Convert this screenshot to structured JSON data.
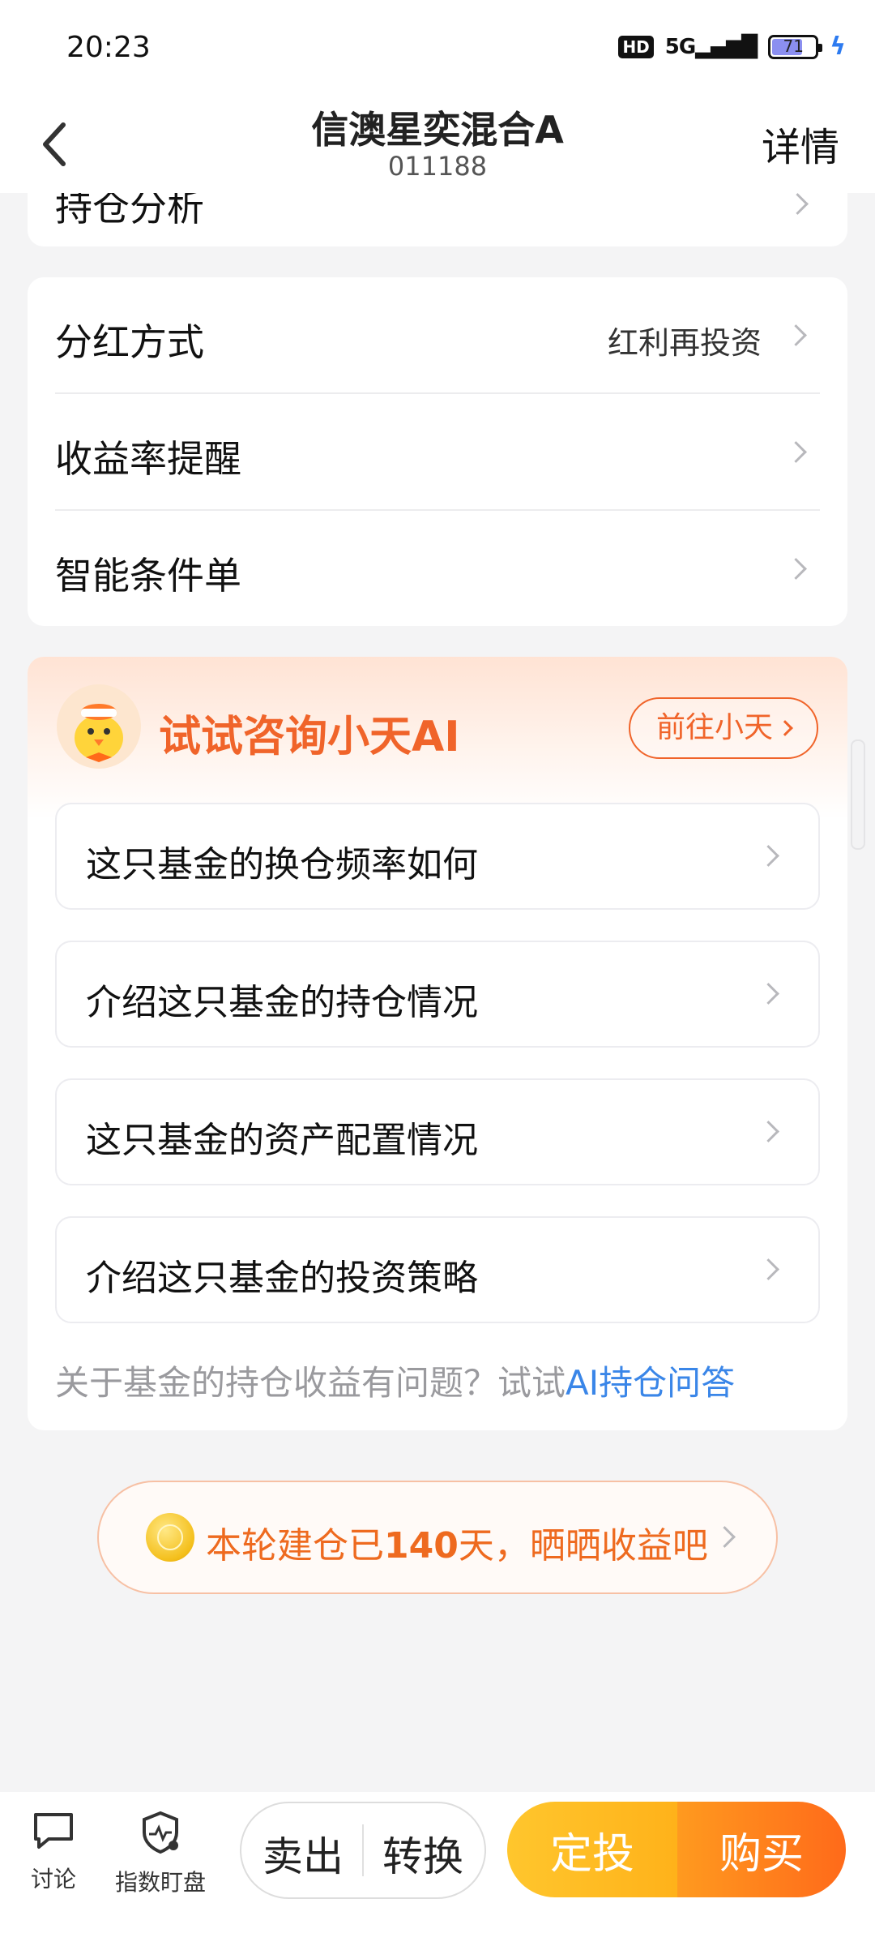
{
  "status_bar": {
    "time": "20:23",
    "hd": "HD",
    "network": "5G",
    "battery": "71",
    "battery_level": 0.71
  },
  "header": {
    "title": "信澳星奕混合A",
    "code": "011188",
    "detail_label": "详情"
  },
  "partial_card": {
    "label": "持仓分析"
  },
  "settings": {
    "rows": [
      {
        "label": "分红方式",
        "value": "红利再投资"
      },
      {
        "label": "收益率提醒",
        "value": ""
      },
      {
        "label": "智能条件单",
        "value": ""
      }
    ]
  },
  "ai_section": {
    "title": "试试咨询小天AI",
    "goto_label": "前往小天",
    "questions": [
      "这只基金的换仓频率如何",
      "介绍这只基金的持仓情况",
      "这只基金的资产配置情况",
      "介绍这只基金的投资策略"
    ],
    "hint_text": "关于基金的持仓收益有问题？试试",
    "hint_link": "AI持仓问答"
  },
  "share_banner": {
    "text_prefix": "本轮建仓已",
    "days": "140",
    "text_suffix": "天，晒晒收益吧"
  },
  "bottom_bar": {
    "discuss_label": "讨论",
    "index_label": "指数盯盘",
    "sell_label": "卖出",
    "convert_label": "转换",
    "fixed_invest_label": "定投",
    "buy_label": "购买"
  },
  "colors": {
    "accent_orange": "#f0642a",
    "link_blue": "#3a86e8",
    "buy_gradient_end": "#ff6a1a",
    "fixed_gradient": "#ffc62d"
  }
}
